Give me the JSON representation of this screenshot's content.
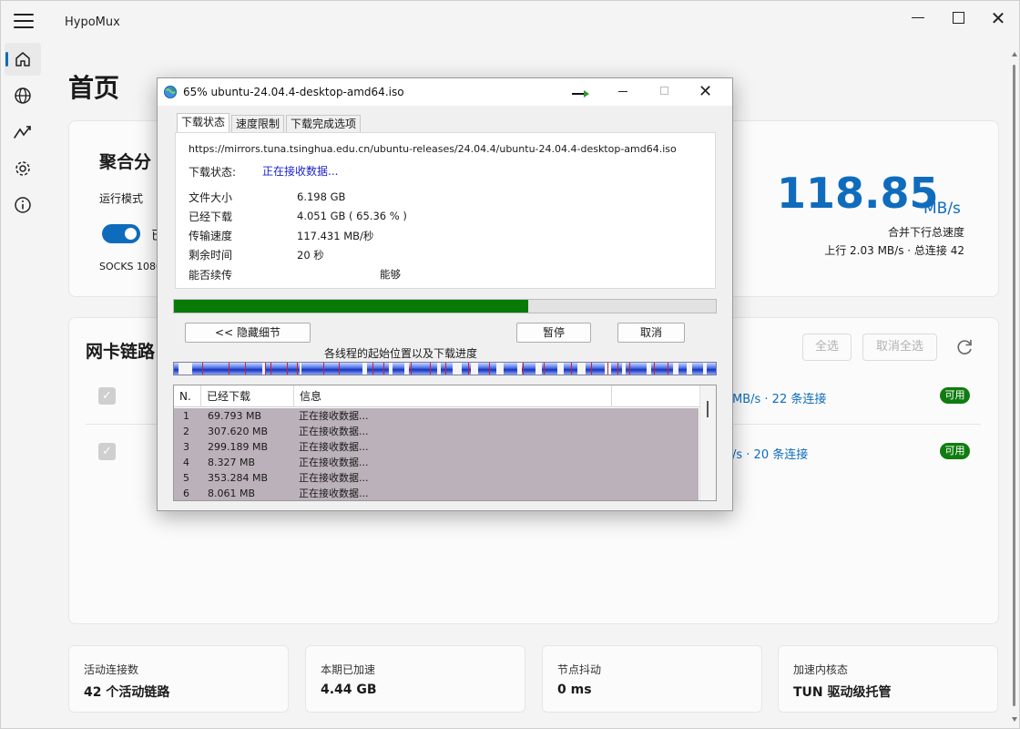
{
  "app": {
    "title": "HypoMux",
    "nav": [
      "home-icon",
      "globe-icon",
      "route-icon",
      "gear-icon",
      "info-icon"
    ]
  },
  "home": {
    "page_title": "首页",
    "aggregate": {
      "title": "聚合分",
      "run_mode_label": "运行模式",
      "toggle_label": "已",
      "socks": "SOCKS 1080"
    },
    "speed": {
      "value": "118.85",
      "unit": "MB/s",
      "label": "合并下行总速度",
      "sub": "上行 2.03 MB/s · 总连接 42"
    },
    "links": {
      "title": "网卡链路",
      "select_all": "全选",
      "unselect_all": "取消全选",
      "rows": [
        {
          "stats": "MB/s · 22 条连接",
          "badge": "可用"
        },
        {
          "stats": "/s · 20 条连接",
          "badge": "可用"
        }
      ]
    },
    "stats": [
      {
        "label": "活动连接数",
        "value": "42 个活动链路"
      },
      {
        "label": "本期已加速",
        "value": "4.44 GB"
      },
      {
        "label": "节点抖动",
        "value": "0 ms"
      },
      {
        "label": "加速内核态",
        "value": "TUN 驱动级托管"
      }
    ]
  },
  "dialog": {
    "title": "65% ubuntu-24.04.4-desktop-amd64.iso",
    "tabs": [
      "下载状态",
      "速度限制",
      "下载完成选项"
    ],
    "url": "https://mirrors.tuna.tsinghua.edu.cn/ubuntu-releases/24.04.4/ubuntu-24.04.4-desktop-amd64.iso",
    "status_label": "下载状态:",
    "status_value": "正在接收数据...",
    "file_size_label": "文件大小",
    "file_size_value": "6.198  GB",
    "downloaded_label": "已经下载",
    "downloaded_value": "4.051  GB ( 65.36 % )",
    "speed_label": "传输速度",
    "speed_value": "117.431  MB/秒",
    "remaining_label": "剩余时间",
    "remaining_value": "20 秒",
    "resume_label": "能否续传",
    "resume_value": "能够",
    "progress": 0.6536,
    "hide_details": "<< 隐藏细节",
    "pause": "暂停",
    "cancel": "取消",
    "threads_caption": "各线程的起始位置以及下载进度",
    "list_headers": [
      "N.",
      "已经下载",
      "信息"
    ],
    "threads": [
      {
        "n": "1",
        "downloaded": "69.793 MB",
        "info": "正在接收数据..."
      },
      {
        "n": "2",
        "downloaded": "307.620 MB",
        "info": "正在接收数据..."
      },
      {
        "n": "3",
        "downloaded": "299.189 MB",
        "info": "正在接收数据..."
      },
      {
        "n": "4",
        "downloaded": "8.327 MB",
        "info": "正在接收数据..."
      },
      {
        "n": "5",
        "downloaded": "353.284 MB",
        "info": "正在接收数据..."
      },
      {
        "n": "6",
        "downloaded": "8.061 MB",
        "info": "正在接收数据..."
      }
    ]
  }
}
